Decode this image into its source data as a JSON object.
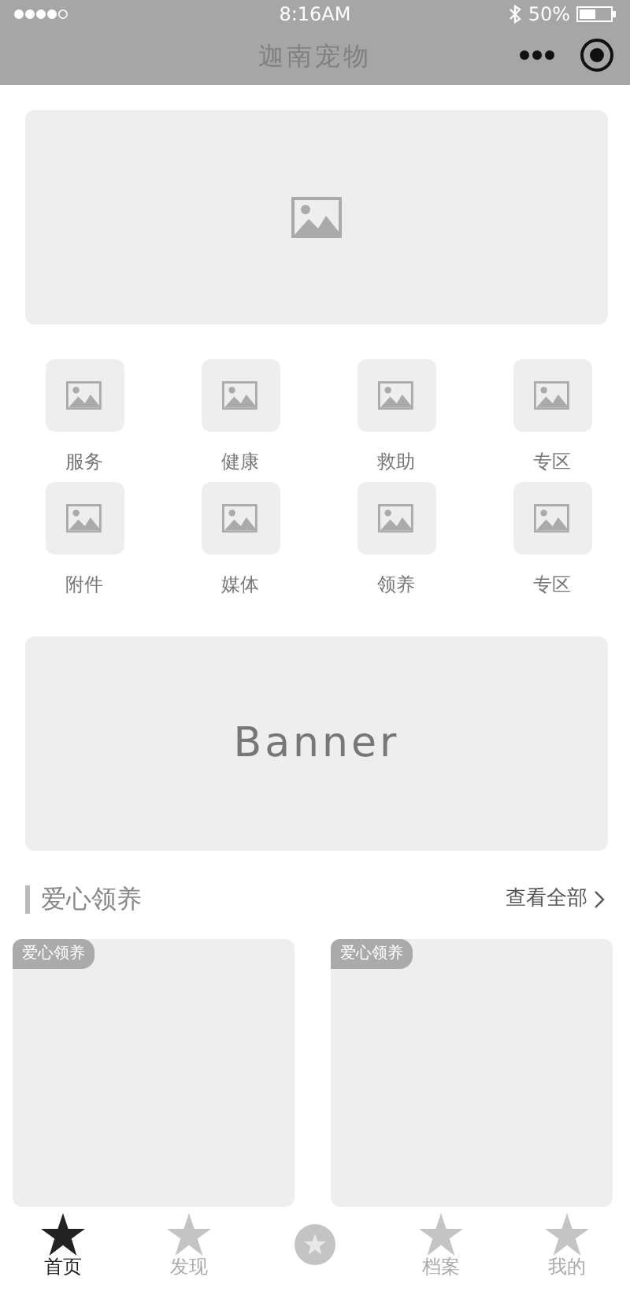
{
  "status_bar": {
    "time": "8:16AM",
    "battery": "50%"
  },
  "nav_bar": {
    "title": "迦南宠物"
  },
  "grid": [
    {
      "label": "服务"
    },
    {
      "label": "健康"
    },
    {
      "label": "救助"
    },
    {
      "label": "专区"
    },
    {
      "label": "附件"
    },
    {
      "label": "媒体"
    },
    {
      "label": "领养"
    },
    {
      "label": "专区"
    }
  ],
  "banner": {
    "text": "Banner"
  },
  "section": {
    "title": "爱心领养",
    "more": "查看全部"
  },
  "cards": [
    {
      "tag": "爱心领养"
    },
    {
      "tag": "爱心领养"
    }
  ],
  "tab_bar": [
    {
      "kind": "tab",
      "label": "首页",
      "selected": true
    },
    {
      "kind": "tab",
      "label": "发现",
      "selected": false
    },
    {
      "kind": "center"
    },
    {
      "kind": "tab",
      "label": "档案",
      "selected": false
    },
    {
      "kind": "tab",
      "label": "我的",
      "selected": false
    }
  ]
}
